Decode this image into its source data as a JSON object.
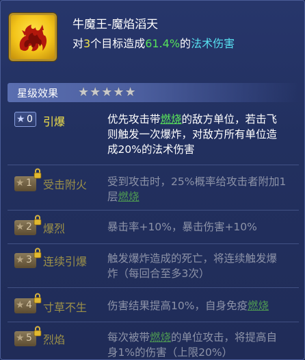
{
  "skill": {
    "icon": "fire-dragon-icon",
    "name": "牛魔王-魔焰滔天",
    "desc": {
      "prefix": "对",
      "targets": "3",
      "middle": "个目标造成",
      "percent": "61.4%",
      "suffix1": "的",
      "damage_type": "法术伤害"
    }
  },
  "star_effects": {
    "title": "星级效果",
    "stars": "★★★★★",
    "star_count": 5,
    "items": [
      {
        "level": "0",
        "name": "引爆",
        "locked": false,
        "parts": [
          "优先攻击带",
          "燃烧",
          "的敌方单位，若击飞则触发一次爆炸，对敌方所有单位造成20%的法术伤害"
        ]
      },
      {
        "level": "1",
        "name": "受击附火",
        "locked": true,
        "parts": [
          "受到攻击时，25%概率给攻击者附加1层",
          "燃烧",
          ""
        ]
      },
      {
        "level": "2",
        "name": "爆烈",
        "locked": true,
        "parts": [
          "暴击率+10%，暴击伤害+10%",
          "",
          ""
        ]
      },
      {
        "level": "3",
        "name": "连续引爆",
        "locked": true,
        "parts": [
          "触发爆炸造成的死亡，将连续触发爆炸（每回合至多3次）",
          "",
          ""
        ]
      },
      {
        "level": "4",
        "name": "寸草不生",
        "locked": true,
        "parts": [
          "伤害结果提高10%，自身免疫",
          "燃烧",
          ""
        ]
      },
      {
        "level": "5",
        "name": "烈焰",
        "locked": true,
        "parts": [
          "每次被带",
          "燃烧",
          "的单位攻击，将提高自身1%的伤害（上限20%）"
        ]
      }
    ]
  },
  "colors": {
    "panel_bg": "#22305f",
    "highlight_yellow": "#f2e44a",
    "highlight_green": "#56e25a",
    "highlight_cyan": "#57e0f0",
    "active_name": "#f3e24a",
    "locked_text": "#8d93a8"
  }
}
